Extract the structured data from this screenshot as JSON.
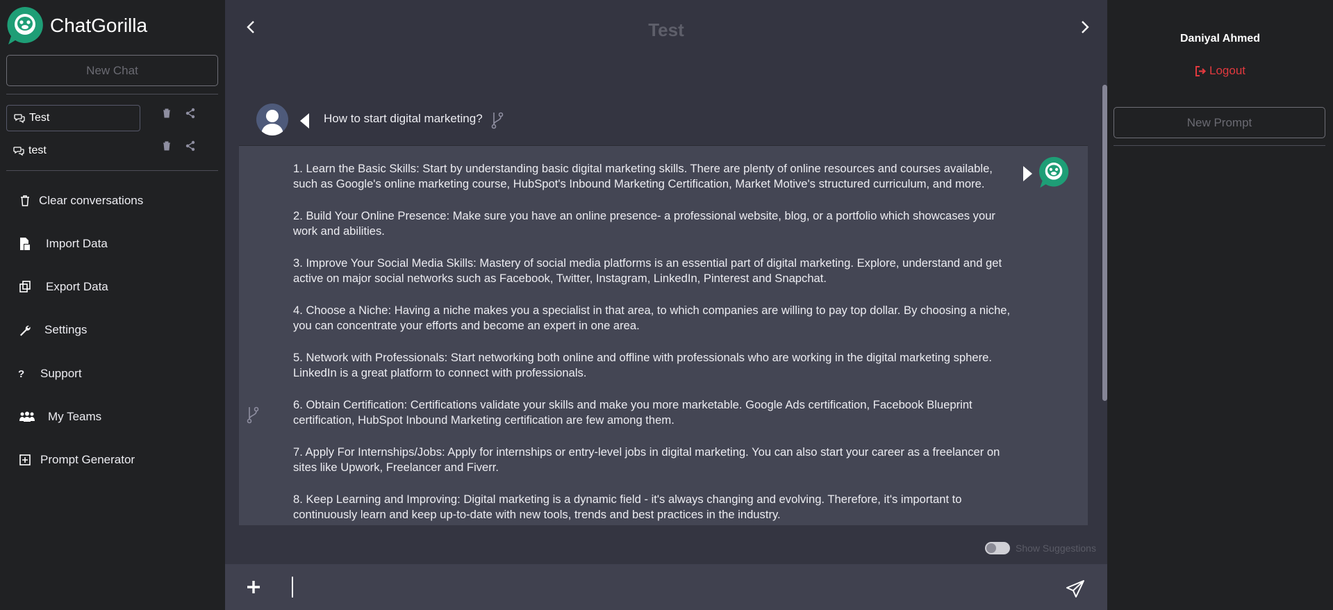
{
  "app": {
    "name": "ChatGorilla"
  },
  "sidebar": {
    "new_chat_label": "New Chat",
    "conversations": [
      {
        "label": "Test"
      },
      {
        "label": "test"
      }
    ],
    "menu": [
      {
        "label": "Clear conversations",
        "icon": "trash-icon"
      },
      {
        "label": "Import Data",
        "icon": "import-icon"
      },
      {
        "label": "Export Data",
        "icon": "export-icon"
      },
      {
        "label": "Settings",
        "icon": "wrench-icon"
      },
      {
        "label": "Support",
        "icon": "question-icon"
      },
      {
        "label": "My Teams",
        "icon": "team-icon"
      },
      {
        "label": "Prompt Generator",
        "icon": "plus-square-icon"
      }
    ]
  },
  "chat": {
    "title": "Test",
    "user_message": "How to start digital marketing?",
    "bot_paragraphs": [
      "1. Learn the Basic Skills: Start by understanding basic digital marketing skills. There are plenty of online resources and courses available, such as Google's online marketing course, HubSpot's Inbound Marketing Certification, Market Motive's structured curriculum, and more.",
      "2. Build Your Online Presence: Make sure you have an online presence- a professional website, blog, or a portfolio which showcases your work and abilities.",
      "3. Improve Your Social Media Skills: Mastery of social media platforms is an essential part of digital marketing. Explore, understand and get active on major social networks such as Facebook, Twitter, Instagram, LinkedIn, Pinterest and Snapchat.",
      "4. Choose a Niche: Having a niche makes you a specialist in that area, to which companies are willing to pay top dollar. By choosing a niche, you can concentrate your efforts and become an expert in one area.",
      "5. Network with Professionals: Start networking both online and offline with professionals who are working in the digital marketing sphere. LinkedIn is a great platform to connect with professionals.",
      "6. Obtain Certification: Certifications validate your skills and make you more marketable. Google Ads certification, Facebook Blueprint certification, HubSpot Inbound Marketing certification are few among them.",
      "7. Apply For Internships/Jobs: Apply for internships or entry-level jobs in digital marketing. You can also start your career as a freelancer on sites like Upwork, Freelancer and Fiverr.",
      "8. Keep Learning and Improving: Digital marketing is a dynamic field - it's always changing and evolving. Therefore, it's important to continuously learn and keep up-to-date with new tools, trends and best practices in the industry."
    ],
    "show_suggestions_label": "Show Suggestions",
    "show_suggestions_on": false,
    "input_value": "",
    "input_placeholder": ""
  },
  "right_panel": {
    "user_name": "Daniyal Ahmed",
    "logout_label": "Logout",
    "new_prompt_label": "New Prompt"
  },
  "colors": {
    "brand": "#1e9e76",
    "logout": "#e0393e",
    "sidebar_bg": "#202123",
    "main_bg": "#343541",
    "bot_bg": "#444654"
  }
}
